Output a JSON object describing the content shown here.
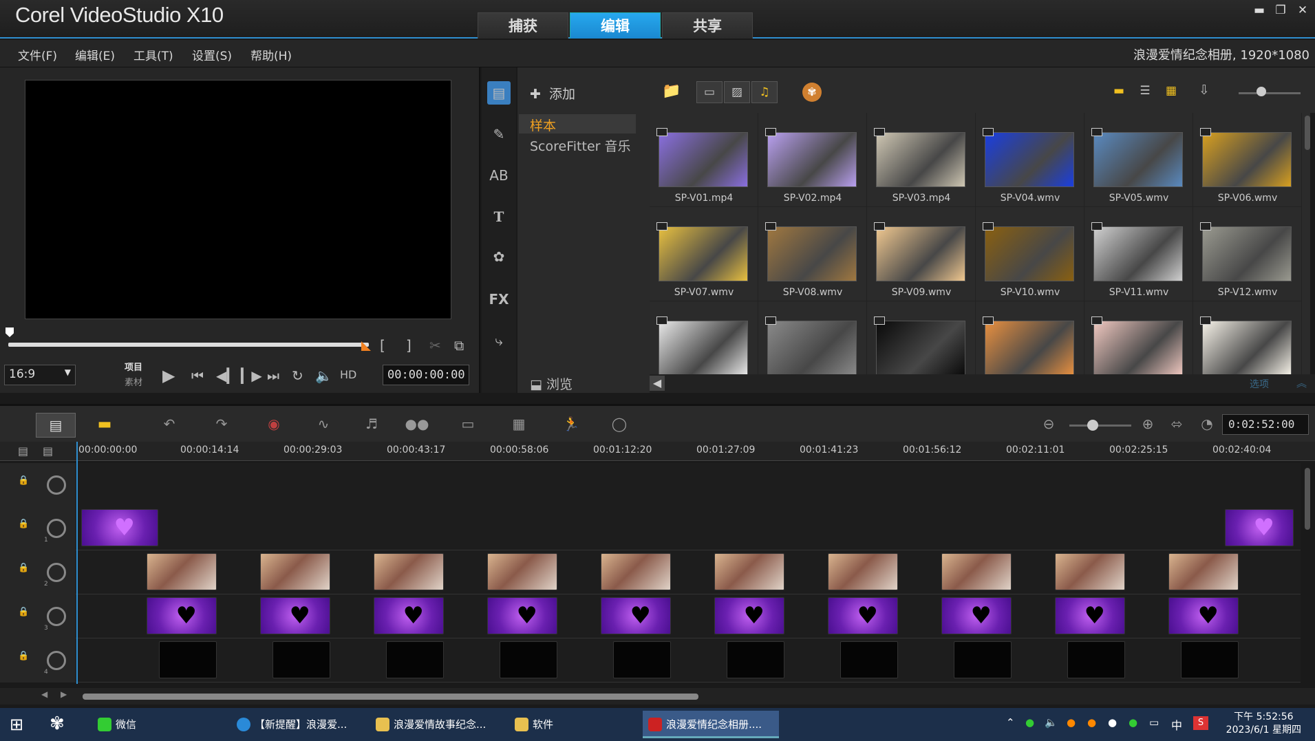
{
  "app": {
    "title": "Corel VideoStudio X10",
    "logo": "Corel VideoStudio X10"
  },
  "main_tabs": [
    "捕获",
    "编辑",
    "共享"
  ],
  "active_tab": "编辑",
  "menu": [
    "文件(F)",
    "编辑(E)",
    "工具(T)",
    "设置(S)",
    "帮助(H)"
  ],
  "project_info": "浪漫爱情纪念相册, 1920*1080",
  "player": {
    "aspect": "16:9",
    "mode_project": "项目",
    "mode_clip": "素材",
    "hd": "HD",
    "timecode": "00:00:00:00"
  },
  "library": {
    "add_label": "添加",
    "folders": [
      "样本",
      "ScoreFitter 音乐"
    ],
    "browse_label": "浏览",
    "options_label": "选项",
    "items": [
      {
        "name": "SP-V01.mp4",
        "color": "#8a6fe0"
      },
      {
        "name": "SP-V02.mp4",
        "color": "#b9a0f0"
      },
      {
        "name": "SP-V03.mp4",
        "color": "#cfc7b3"
      },
      {
        "name": "SP-V04.wmv",
        "color": "#1a3ee0"
      },
      {
        "name": "SP-V05.wmv",
        "color": "#5a8ac0"
      },
      {
        "name": "SP-V06.wmv",
        "color": "#d8a020"
      },
      {
        "name": "SP-V07.wmv",
        "color": "#e8c040"
      },
      {
        "name": "SP-V08.wmv",
        "color": "#a07840"
      },
      {
        "name": "SP-V09.wmv",
        "color": "#f0c890"
      },
      {
        "name": "SP-V10.wmv",
        "color": "#8a6010"
      },
      {
        "name": "SP-V11.wmv",
        "color": "#d0d0d0"
      },
      {
        "name": "SP-V12.wmv",
        "color": "#9a9a90"
      },
      {
        "name": "",
        "color": "#e8e8e8"
      },
      {
        "name": "",
        "color": "#8a8a8a"
      },
      {
        "name": "",
        "color": "#0a0a0a"
      },
      {
        "name": "",
        "color": "#e89040"
      },
      {
        "name": "",
        "color": "#f0c8c0"
      },
      {
        "name": "",
        "color": "#f6f2e8"
      }
    ]
  },
  "timeline": {
    "timecode": "0:02:52:00",
    "ruler": [
      "00:00:00:00",
      "00:00:14:14",
      "00:00:29:03",
      "00:00:43:17",
      "00:00:58:06",
      "00:01:12:20",
      "00:01:27:09",
      "00:01:41:23",
      "00:01:56:12",
      "00:02:11:01",
      "00:02:25:15",
      "00:02:40:04"
    ],
    "track_numbers": [
      "",
      "1",
      "2",
      "3",
      "4"
    ]
  },
  "taskbar": {
    "items": [
      "微信",
      "【新提醒】浪漫爱...",
      "浪漫爱情故事纪念...",
      "软件",
      "浪漫爱情纪念相册...."
    ],
    "ime": "中",
    "time": "下午 5:52:56",
    "date": "2023/6/1 星期四"
  }
}
